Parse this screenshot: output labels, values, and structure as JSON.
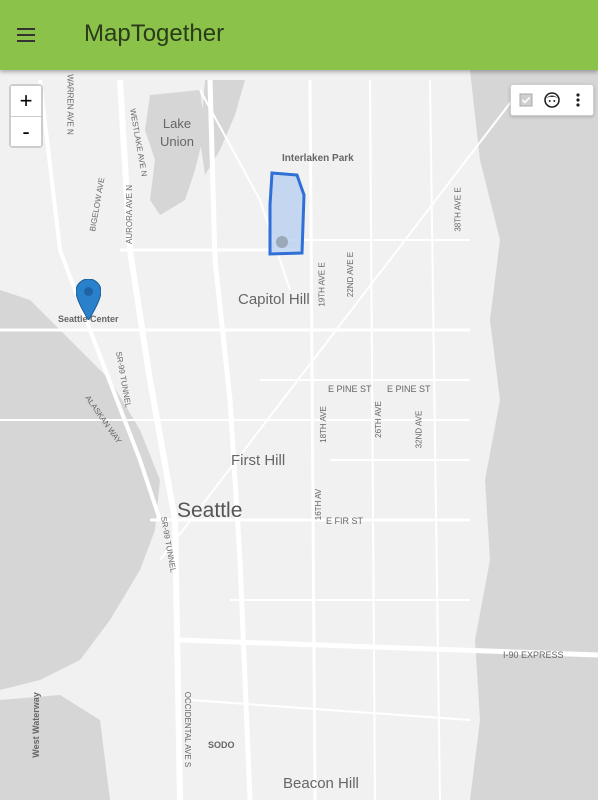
{
  "app": {
    "title": "MapTogether"
  },
  "header": {
    "menu_icon": "hamburger-menu-icon"
  },
  "zoom": {
    "in_label": "+",
    "out_label": "-"
  },
  "toolbox": {
    "icons": [
      "checkbox-icon",
      "face-icon",
      "more-vertical-icon"
    ]
  },
  "map": {
    "labels": {
      "lake_union": "Lake Union",
      "interlaken_park": "Interlaken Park",
      "capitol_hill": "Capitol Hill",
      "seattle_center": "Seattle Center",
      "first_hill": "First Hill",
      "seattle": "Seattle",
      "sodo": "SODO",
      "beacon_hill": "Beacon Hill",
      "west_waterway": "West Waterway",
      "i90_express": "I-90 EXPRESS",
      "e_pine_st_1": "E PINE ST",
      "e_pine_st_2": "E PINE ST",
      "e_fir_st": "E FIR ST",
      "warren_ave_n": "WARREN AVE N",
      "westlake_ave_n": "WESTLAKE AVE N",
      "bigelow_ave": "BIGELOW AVE",
      "aurora_ave_n": "AURORA AVE N",
      "st_19th_ave_e": "19TH AVE E",
      "nd_22nd_ave_e": "22ND AVE E",
      "th_38th_ave_e": "38TH AVE E",
      "th_18th_ave": "18TH AVE",
      "th_26th_ave": "26TH AVE",
      "nd_32nd_ave": "32ND AVE",
      "th_16th_av": "16TH AV",
      "tunnel_sr99_1": "SR-99 TUNNEL",
      "tunnel_sr99_2": "SR-99 TUNNEL",
      "alaskan_way": "ALASKAN WAY",
      "occidental_ave_s": "OCCIDENTAL AVE S"
    },
    "marker_icon": "map-pin-icon",
    "shape_name": "drawn-polygon"
  }
}
